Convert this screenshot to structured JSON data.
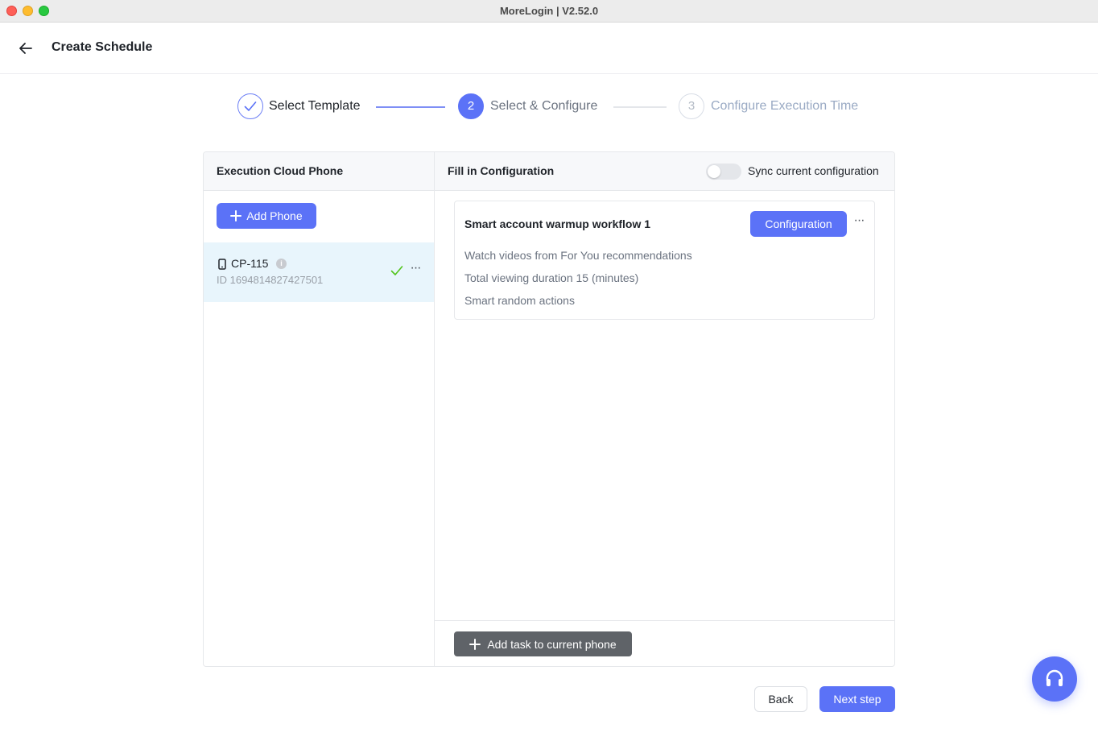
{
  "window": {
    "title": "MoreLogin | V2.52.0"
  },
  "header": {
    "title": "Create Schedule"
  },
  "steps": [
    {
      "number": "1",
      "label": "Select Template",
      "state": "done"
    },
    {
      "number": "2",
      "label": "Select & Configure",
      "state": "active"
    },
    {
      "number": "3",
      "label": "Configure Execution Time",
      "state": "pending"
    }
  ],
  "left_panel": {
    "title": "Execution Cloud Phone",
    "add_button": "Add Phone",
    "phones": [
      {
        "name": "CP-115",
        "id": "ID 1694814827427501",
        "status": "configured"
      }
    ]
  },
  "right_panel": {
    "title": "Fill in Configuration",
    "sync_label": "Sync current configuration",
    "sync_enabled": false,
    "tasks": [
      {
        "title": "Smart account warmup workflow 1",
        "config_button": "Configuration",
        "lines": [
          "Watch videos from For You recommendations",
          "Total viewing duration 15 (minutes)",
          "Smart random actions"
        ]
      }
    ],
    "add_task_button": "Add task to current phone"
  },
  "footer": {
    "back_label": "Back",
    "next_label": "Next step"
  },
  "colors": {
    "accent": "#5b72f7",
    "selected_row": "#e8f5fc",
    "success": "#52c41a"
  },
  "icons": [
    "back-arrow-icon",
    "check-icon",
    "plus-icon",
    "phone-icon",
    "info-icon",
    "more-icon",
    "headset-icon"
  ]
}
